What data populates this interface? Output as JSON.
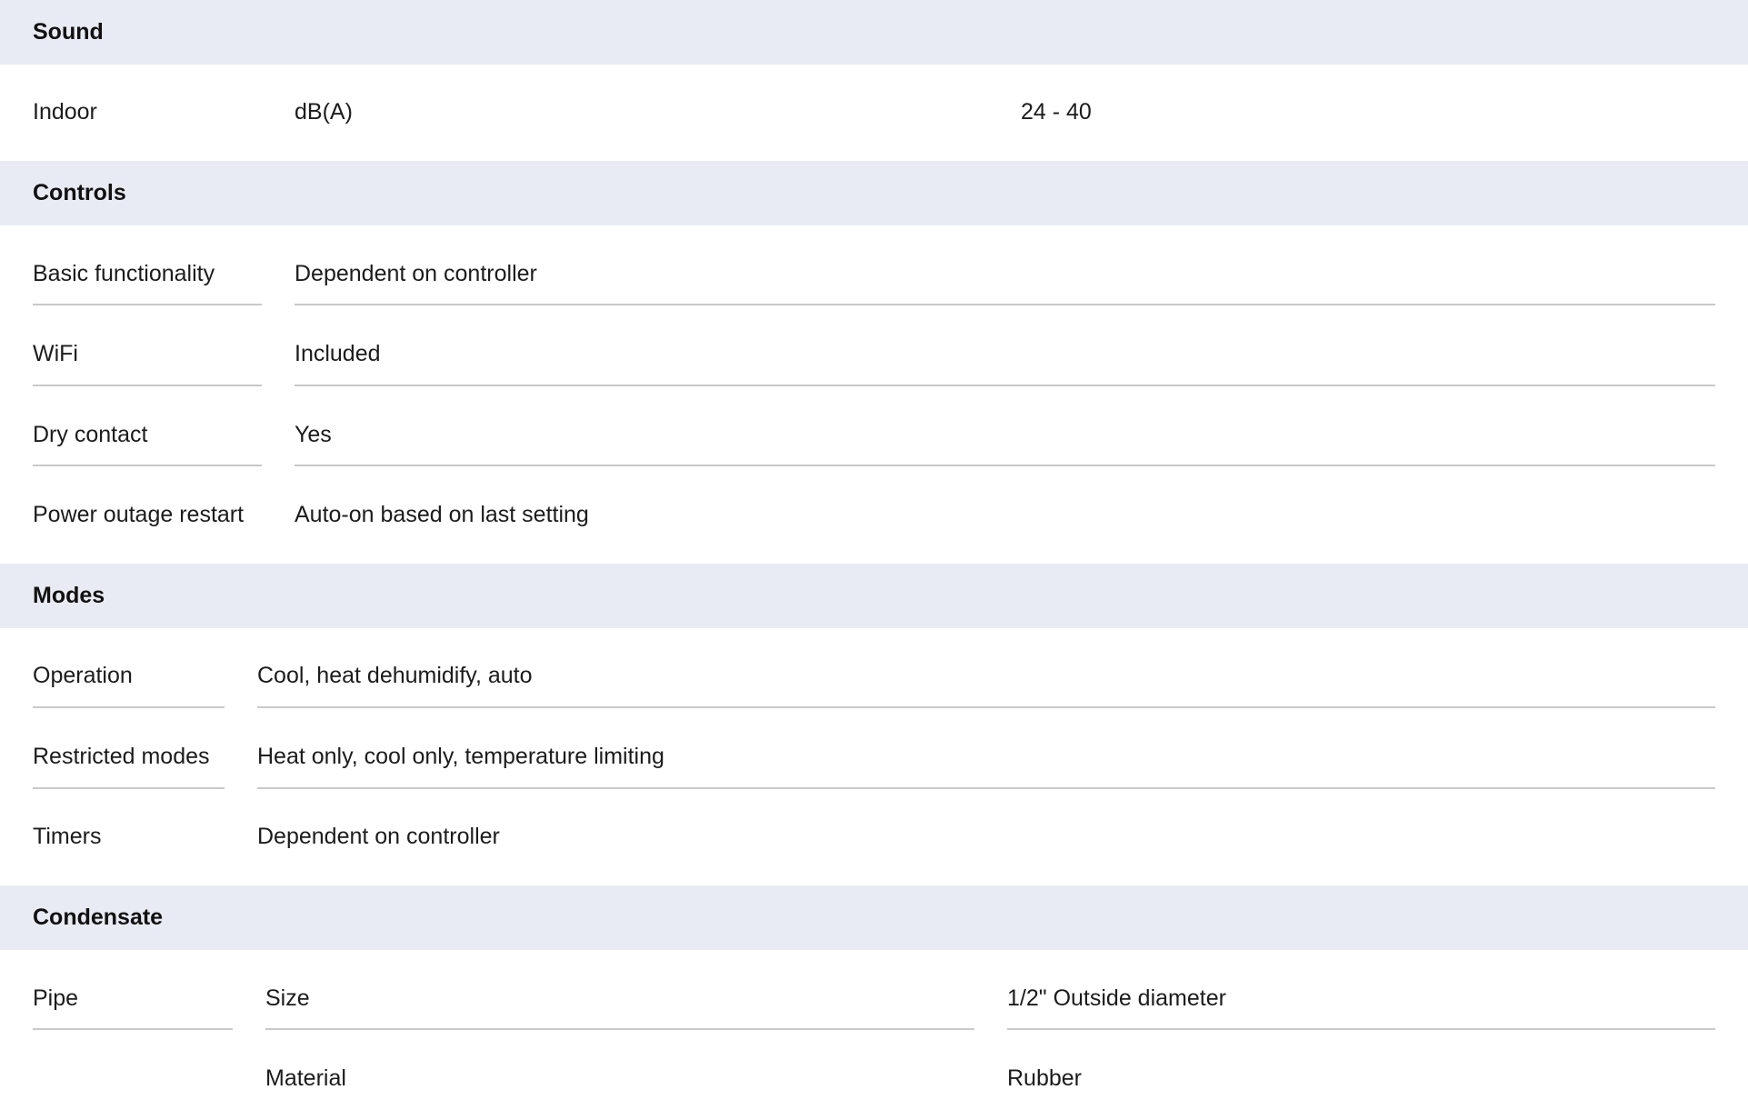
{
  "sections": {
    "sound": {
      "title": "Sound",
      "rows": [
        {
          "label": "Indoor",
          "unit": "dB(A)",
          "value": "24 - 40"
        }
      ]
    },
    "controls": {
      "title": "Controls",
      "rows": [
        {
          "label": "Basic functionality",
          "value": "Dependent on controller"
        },
        {
          "label": "WiFi",
          "value": "Included"
        },
        {
          "label": "Dry contact",
          "value": "Yes"
        },
        {
          "label": "Power outage restart",
          "value": "Auto-on based on last setting"
        }
      ]
    },
    "modes": {
      "title": "Modes",
      "rows": [
        {
          "label": "Operation",
          "value": "Cool, heat dehumidify, auto"
        },
        {
          "label": "Restricted modes",
          "value": "Heat only, cool only, temperature limiting"
        },
        {
          "label": "Timers",
          "value": "Dependent on controller"
        }
      ]
    },
    "condensate": {
      "title": "Condensate",
      "rows": [
        {
          "label": "Pipe",
          "sublabel": "Size",
          "value": "1/2\" Outside diameter"
        },
        {
          "label": "",
          "sublabel": "Material",
          "value": "Rubber"
        }
      ]
    }
  }
}
